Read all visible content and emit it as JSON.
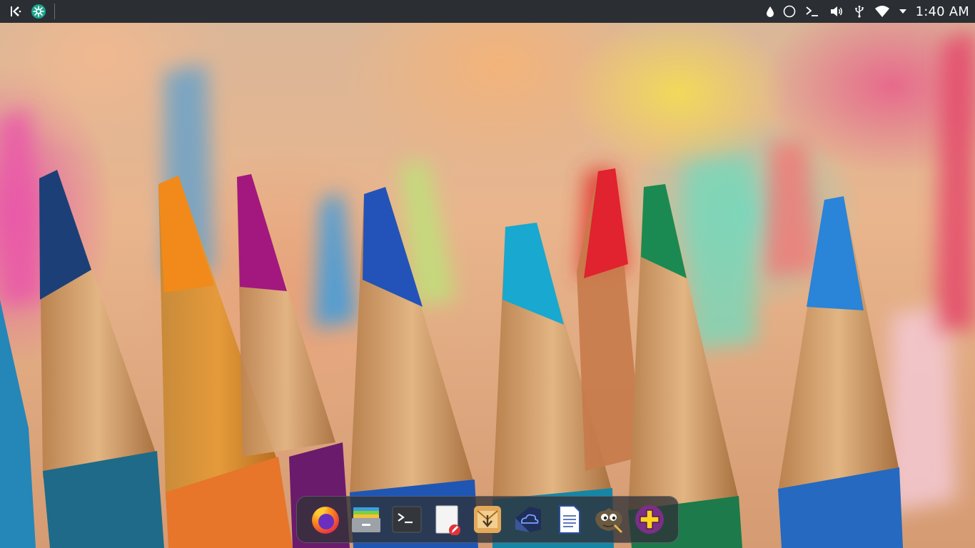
{
  "top_panel": {
    "left": [
      {
        "name": "application-launcher",
        "icon": "kde-logo-icon"
      },
      {
        "name": "discover",
        "icon": "discover-icon"
      }
    ],
    "tray": [
      {
        "name": "color-picker",
        "icon": "droplet-icon"
      },
      {
        "name": "activity",
        "icon": "circle-icon"
      },
      {
        "name": "konsole-tray",
        "icon": "terminal-prompt-icon"
      },
      {
        "name": "volume",
        "icon": "speaker-icon"
      },
      {
        "name": "usb-devices",
        "icon": "usb-icon"
      },
      {
        "name": "network",
        "icon": "wifi-icon"
      },
      {
        "name": "tray-expand",
        "icon": "triangle-down-icon"
      }
    ],
    "clock": "1:40 AM"
  },
  "dock": {
    "items": [
      {
        "name": "firefox",
        "icon": "firefox-icon"
      },
      {
        "name": "file-manager",
        "icon": "file-manager-icon"
      },
      {
        "name": "terminal",
        "icon": "terminal-icon"
      },
      {
        "name": "text-editor",
        "icon": "text-editor-icon"
      },
      {
        "name": "downloader",
        "icon": "download-manager-icon"
      },
      {
        "name": "cloud-storage",
        "icon": "cloud-icon"
      },
      {
        "name": "writer",
        "icon": "document-icon"
      },
      {
        "name": "gimp",
        "icon": "gimp-icon"
      },
      {
        "name": "package-installer",
        "icon": "plus-icon"
      }
    ]
  },
  "colors": {
    "panel_bg": "#2b2e33",
    "dock_bg": "#303238",
    "firefox_orange": "#ff7b1a",
    "gimp_brown": "#6b5a42",
    "installer_purple": "#7b2f86",
    "installer_yellow": "#ffd21f"
  }
}
